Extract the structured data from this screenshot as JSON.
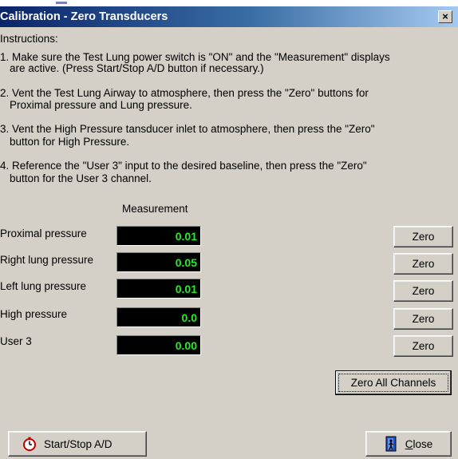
{
  "window": {
    "title": "Calibration - Zero Transducers",
    "close_glyph": "×"
  },
  "instructions": {
    "heading": "Instructions:",
    "steps": [
      {
        "line1": "1. Make sure the Test Lung power switch is \"ON\" and the \"Measurement\" displays",
        "line2": "are active.  (Press Start/Stop A/D button if necessary.)"
      },
      {
        "line1": "2. Vent the Test Lung Airway to atmosphere, then press the \"Zero\" buttons for",
        "line2": "Proximal pressure and Lung pressure."
      },
      {
        "line1": "3. Vent the High Pressure tansducer inlet to atmosphere, then press the \"Zero\"",
        "line2": "button for High Pressure."
      },
      {
        "line1": "4. Reference the \"User 3\" input to the desired baseline, then press the \"Zero\"",
        "line2": "button for the User 3 channel."
      }
    ]
  },
  "measurement_header": "Measurement",
  "channels": [
    {
      "label": "Proximal pressure",
      "value": "0.01",
      "button": "Zero"
    },
    {
      "label": "Right lung pressure",
      "value": "0.05",
      "button": "Zero"
    },
    {
      "label": "Left lung pressure",
      "value": "0.01",
      "button": "Zero"
    },
    {
      "label": "High pressure",
      "value": "0.0",
      "button": "Zero"
    },
    {
      "label": "User 3",
      "value": "0.00",
      "button": "Zero"
    }
  ],
  "buttons": {
    "zero_all": "Zero All Channels",
    "start_stop": "Start/Stop A/D",
    "close": "Close"
  },
  "icons": {
    "start_stop": "stopwatch-icon",
    "close": "door-exit-icon"
  },
  "colors": {
    "title_gradient_start": "#0a246a",
    "title_gradient_end": "#a6caf0",
    "dialog_face": "#d4d0c8",
    "lcd_background": "#000000",
    "lcd_text": "#22ee22"
  }
}
